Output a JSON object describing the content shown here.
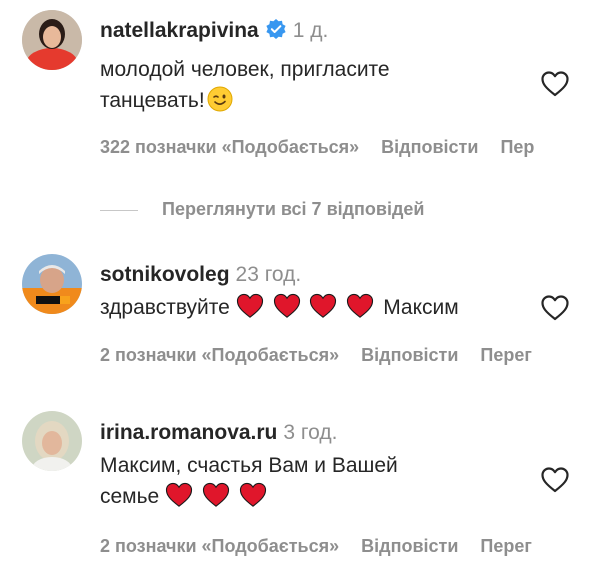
{
  "comments": [
    {
      "username": "natellakrapivina",
      "time": "1 д.",
      "verified": true,
      "text_line1": "молодой человек, пригласите",
      "text_line2": "танцевать!",
      "likes": "322 позначки «Подобається»",
      "reply": "Відповісти",
      "translate": "Пер"
    },
    {
      "username": "sotnikovoleg",
      "time": "23 год.",
      "text_before": "здравствуйте",
      "text_after": "Максим",
      "likes": "2 позначки «Подобається»",
      "reply": "Відповісти",
      "translate": "Перег"
    },
    {
      "username": "irina.romanova.ru",
      "time": "3 год.",
      "text_line1": "Максим, счастья Вам и Вашей",
      "text_line2": "семье",
      "likes": "2 позначки «Подобається»",
      "reply": "Відповісти",
      "translate": "Перег"
    }
  ],
  "view_replies": "Переглянути всі 7 відповідей",
  "colors": {
    "heart": "#e0162b",
    "muted": "#8e8e8e",
    "verified": "#3897f0",
    "text": "#262626"
  }
}
